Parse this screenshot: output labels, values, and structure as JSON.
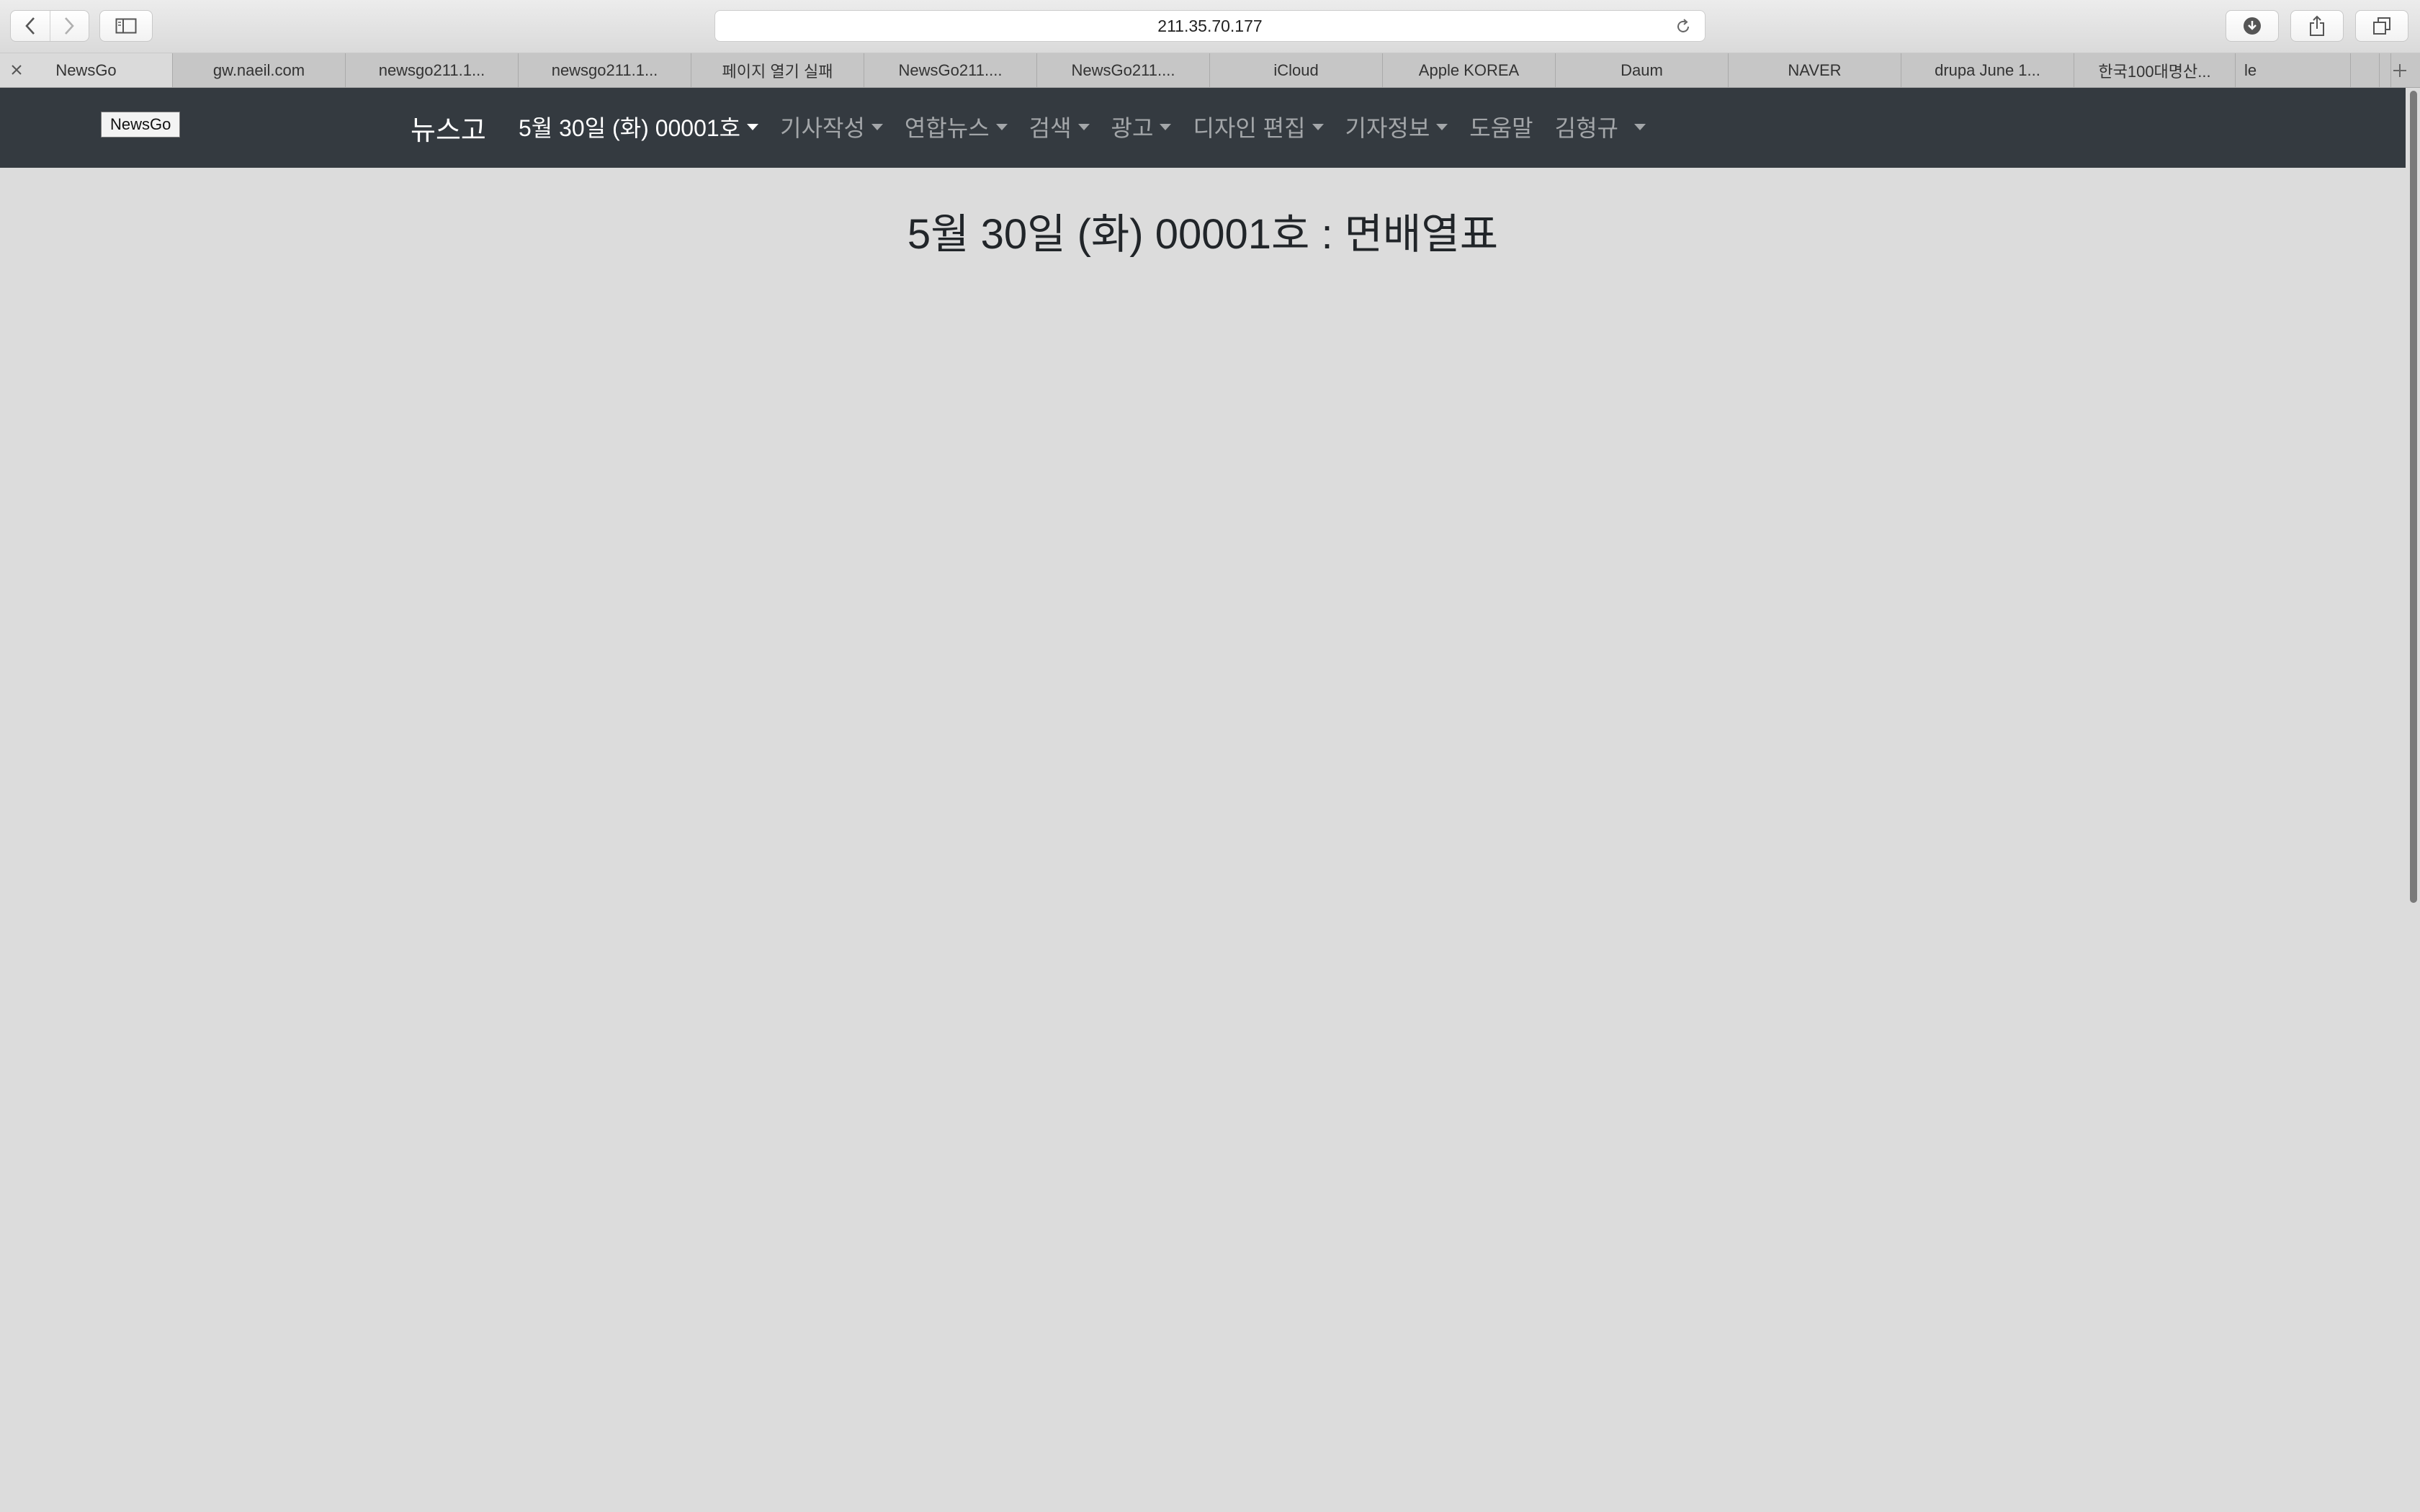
{
  "browser": {
    "address": "211.35.70.177",
    "tabs": [
      {
        "label": "NewsGo",
        "active": true
      },
      {
        "label": "gw.naeil.com"
      },
      {
        "label": "newsgo211.1..."
      },
      {
        "label": "newsgo211.1..."
      },
      {
        "label": "페이지 열기 실패"
      },
      {
        "label": "NewsGo211...."
      },
      {
        "label": "NewsGo211...."
      },
      {
        "label": "iCloud"
      },
      {
        "label": "Apple KOREA"
      },
      {
        "label": "Daum"
      },
      {
        "label": "NAVER"
      },
      {
        "label": "drupa June 1..."
      },
      {
        "label": "한국100대명산..."
      },
      {
        "label": "le"
      },
      {
        "label": ""
      }
    ],
    "icons": {
      "back": "chevron-left-icon",
      "forward": "chevron-right-icon",
      "sidebar": "sidebar-icon",
      "reload": "reload-icon",
      "download": "download-icon",
      "share": "share-icon",
      "tabs": "tab-overview-icon",
      "close_tab": "close-icon",
      "new_tab": "plus-icon"
    }
  },
  "navbar": {
    "badge": "NewsGo",
    "brand": "뉴스고",
    "menu": [
      {
        "label": "5월 30일 (화) 00001호",
        "dropdown": true,
        "active": true
      },
      {
        "label": "기사작성",
        "dropdown": true
      },
      {
        "label": "연합뉴스",
        "dropdown": true
      },
      {
        "label": "검색",
        "dropdown": true
      },
      {
        "label": "광고",
        "dropdown": true
      },
      {
        "label": "디자인 편집",
        "dropdown": true
      },
      {
        "label": "기자정보",
        "dropdown": true
      },
      {
        "label": "도움말",
        "dropdown": false
      },
      {
        "label": "김형규",
        "dropdown": true
      }
    ],
    "colors": {
      "background": "#343a40",
      "active_text": "#ffffff",
      "inactive_text": "#9a9da0"
    }
  },
  "content": {
    "title": "5월 30일 (화) 00001호 : 면배열표",
    "background": "#dcdcdc"
  }
}
